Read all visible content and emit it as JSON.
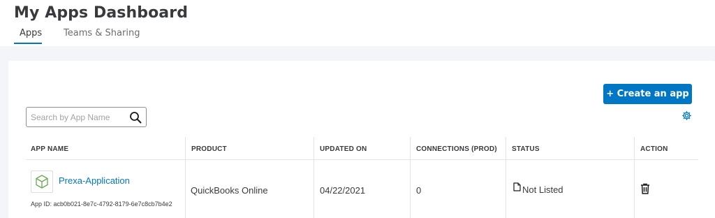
{
  "header": {
    "title": "My Apps Dashboard",
    "tabs": [
      {
        "label": "Apps",
        "active": true
      },
      {
        "label": "Teams & Sharing",
        "active": false
      }
    ]
  },
  "toolbar": {
    "create_label": "+ Create an app",
    "search_placeholder": "Search by App Name",
    "search_value": ""
  },
  "table": {
    "columns": [
      "APP NAME",
      "PRODUCT",
      "UPDATED ON",
      "CONNECTIONS (PROD)",
      "STATUS",
      "ACTION"
    ],
    "rows": [
      {
        "app_name": "Prexa-Application",
        "app_id": "App ID: acb0b021-8e7c-4792-8179-6e7c8cb7b4e2",
        "product": "QuickBooks Online",
        "updated_on": "04/22/2021",
        "connections": "0",
        "status": "Not Listed",
        "status_icon": "document-icon",
        "action_icon": "trash-icon"
      }
    ]
  },
  "colors": {
    "accent": "#0077c5",
    "text": "#393a3d",
    "background": "#f4f5f8"
  }
}
